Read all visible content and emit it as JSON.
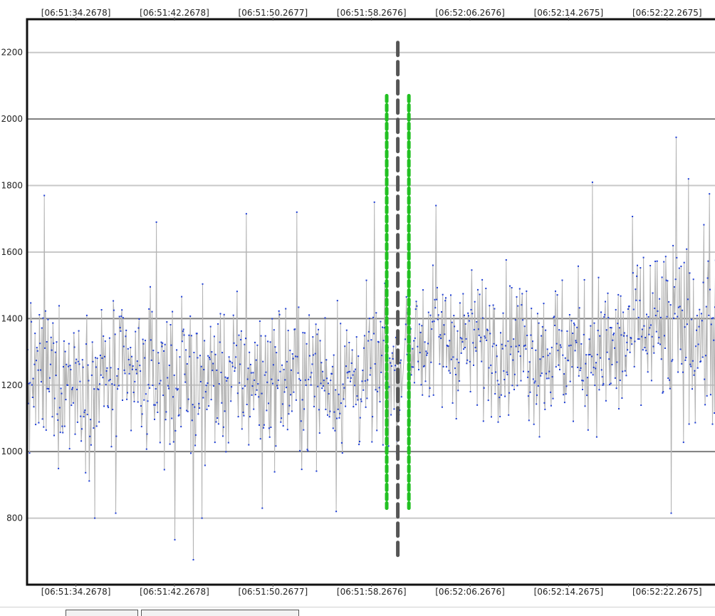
{
  "chart_data": {
    "type": "line",
    "title": "",
    "xlabel": "",
    "ylabel": "",
    "x_tick_labels": [
      "[06:51:34.2678]",
      "[06:51:42.2678]",
      "[06:51:50.2677]",
      "[06:51:58.2676]",
      "[06:52:06.2676]",
      "[06:52:14.2675]",
      "[06:52:22.2675]"
    ],
    "x_tick_seconds": [
      34.2678,
      42.2678,
      50.2677,
      58.2676,
      66.2676,
      74.2675,
      82.2675
    ],
    "xlim_seconds": [
      30.3,
      86.5
    ],
    "y_ticks": [
      800,
      1000,
      1200,
      1400,
      1600,
      1800,
      2000,
      2200
    ],
    "y_major_lines": [
      1000,
      1400,
      2000
    ],
    "ylim": [
      600,
      2300
    ],
    "grid": true,
    "series": [
      {
        "name": "",
        "color": "#1f3fd6",
        "line_color": "#b4b4b4",
        "sample_interval_s": 0.05,
        "segments": [
          {
            "from_s": 30.3,
            "to_s": 60.7,
            "mean": 1220,
            "spread": 170
          },
          {
            "from_s": 61.0,
            "to_s": 71.0,
            "mean": 1330,
            "spread": 160
          },
          {
            "from_s": 71.0,
            "to_s": 79.0,
            "mean": 1300,
            "spread": 170
          },
          {
            "from_s": 79.0,
            "to_s": 86.5,
            "mean": 1360,
            "spread": 200
          }
        ],
        "peaks": [
          {
            "x_s": 31.7,
            "y": 1770
          },
          {
            "x_s": 40.8,
            "y": 1690
          },
          {
            "x_s": 48.1,
            "y": 1715
          },
          {
            "x_s": 52.2,
            "y": 1720
          },
          {
            "x_s": 58.5,
            "y": 1750
          },
          {
            "x_s": 63.5,
            "y": 1740
          },
          {
            "x_s": 76.2,
            "y": 1810
          },
          {
            "x_s": 83.0,
            "y": 1945
          },
          {
            "x_s": 84.0,
            "y": 1820
          },
          {
            "x_s": 85.7,
            "y": 1775
          }
        ],
        "troughs": [
          {
            "x_s": 35.8,
            "y": 800
          },
          {
            "x_s": 37.5,
            "y": 815
          },
          {
            "x_s": 42.3,
            "y": 735
          },
          {
            "x_s": 43.8,
            "y": 675
          },
          {
            "x_s": 44.5,
            "y": 800
          },
          {
            "x_s": 49.4,
            "y": 830
          },
          {
            "x_s": 55.4,
            "y": 820
          },
          {
            "x_s": 82.6,
            "y": 815
          }
        ]
      }
    ],
    "markers": [
      {
        "kind": "center",
        "x_s": 60.4,
        "y_from": 670,
        "y_to": 2230,
        "color": "#555555"
      },
      {
        "kind": "bound",
        "x_s": 59.5,
        "y_from": 830,
        "y_to": 2070,
        "color": "#22c022"
      },
      {
        "kind": "bound",
        "x_s": 61.3,
        "y_from": 830,
        "y_to": 2070,
        "color": "#22c022"
      }
    ]
  }
}
